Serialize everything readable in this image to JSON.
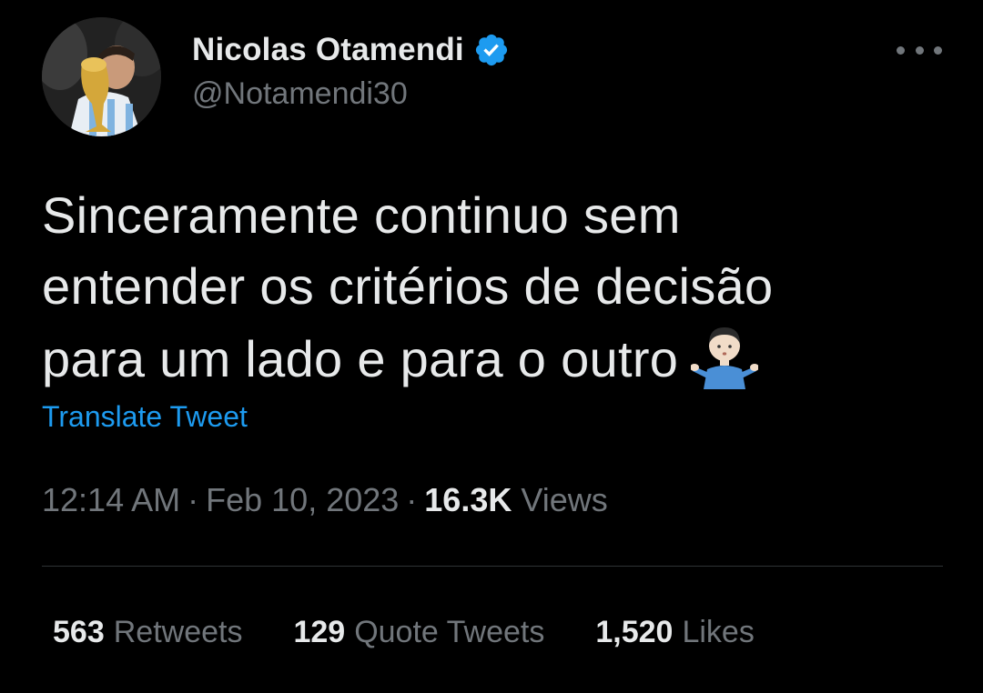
{
  "author": {
    "display_name": "Nicolas Otamendi",
    "handle": "@Notamendi30",
    "verified": true,
    "verified_color": "#1d9bf0"
  },
  "tweet": {
    "lines": [
      "Sinceramente continuo sem",
      "entender os critérios de decisão",
      "para um lado e para o outro"
    ],
    "emoji": "person-shrugging-icon"
  },
  "translate_label": "Translate Tweet",
  "meta": {
    "time": "12:14 AM",
    "separator": "·",
    "date": "Feb 10, 2023",
    "views_count": "16.3K",
    "views_label": "Views"
  },
  "stats": {
    "retweets_count": "563",
    "retweets_label": "Retweets",
    "quotes_count": "129",
    "quotes_label": "Quote Tweets",
    "likes_count": "1,520",
    "likes_label": "Likes"
  },
  "colors": {
    "background": "#000000",
    "text_primary": "#e7e9ea",
    "text_secondary": "#71767b",
    "link": "#1d9bf0",
    "divider": "#2f3336"
  }
}
